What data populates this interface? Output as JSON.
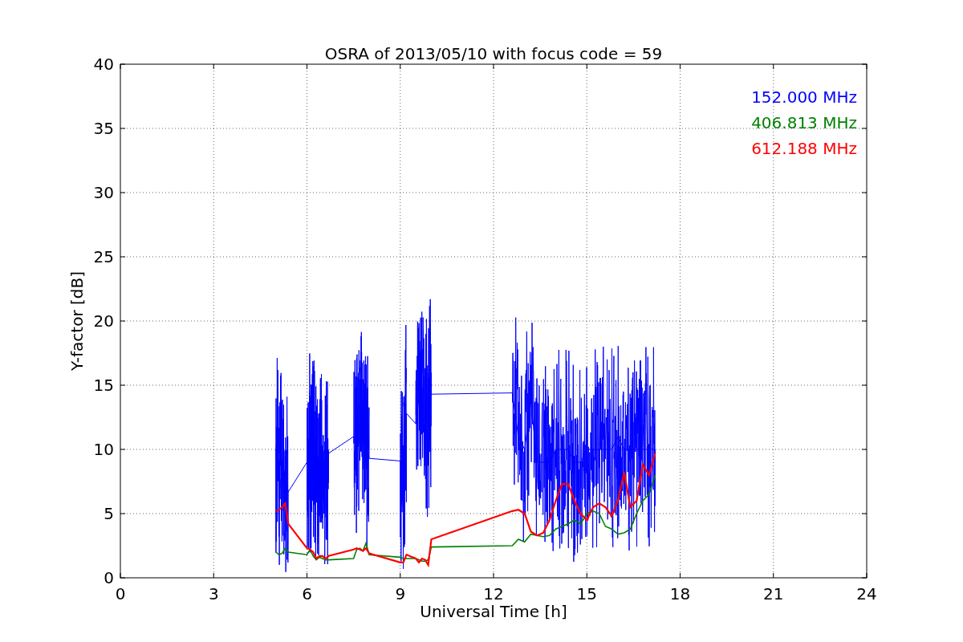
{
  "figure": {
    "chart_data": {
      "type": "line",
      "title": "OSRA of 2013/05/10 with focus code = 59",
      "xlabel": "Universal Time [h]",
      "ylabel": "Y-factor [dB]",
      "x": [
        5.0,
        5.1,
        5.2,
        5.3,
        5.4,
        6.0,
        6.1,
        6.2,
        6.3,
        6.4,
        6.5,
        6.6,
        6.7,
        7.5,
        7.6,
        7.7,
        7.8,
        7.9,
        8.0,
        9.0,
        9.1,
        9.2,
        9.5,
        9.6,
        9.7,
        9.8,
        9.9,
        10.0,
        12.6,
        12.8,
        13.0,
        13.2,
        13.4,
        13.6,
        13.8,
        14.0,
        14.2,
        14.4,
        14.6,
        14.8,
        15.0,
        15.2,
        15.4,
        15.6,
        15.8,
        16.0,
        16.2,
        16.4,
        16.6,
        16.8,
        17.0,
        17.2
      ],
      "series": [
        {
          "name": "152.000 MHz",
          "color": "#0000ff",
          "values": [
            10,
            9,
            9,
            8,
            6.7,
            9,
            10,
            10,
            9,
            8,
            8,
            7,
            9.7,
            11,
            11,
            12,
            11,
            10,
            9.3,
            9.1,
            8,
            12.8,
            12,
            14,
            13,
            12,
            13,
            14.3,
            14.4,
            11,
            10,
            13.8,
            9,
            9,
            9,
            10,
            10,
            10,
            9,
            9,
            10,
            10,
            10,
            10,
            10,
            11,
            10,
            10,
            10,
            10,
            10,
            10
          ]
        },
        {
          "name": "406.813 MHz",
          "color": "#008000",
          "values": [
            2,
            1.8,
            1.9,
            2.3,
            2.0,
            1.8,
            2.2,
            1.7,
            1.4,
            1.6,
            1.5,
            1.4,
            1.4,
            1.5,
            2.2,
            2.3,
            2.1,
            2.7,
            1.8,
            1.6,
            1.5,
            1.5,
            1.5,
            1.4,
            1.3,
            1.3,
            1.4,
            2.4,
            2.5,
            3,
            2.8,
            3.4,
            3.3,
            3.2,
            3.3,
            3.8,
            4,
            4.2,
            4.5,
            4.2,
            5,
            5.2,
            5,
            4,
            3.8,
            3.4,
            3.5,
            3.8,
            5,
            6,
            6.5,
            8
          ]
        },
        {
          "name": "612.188 MHz",
          "color": "#ff0000",
          "values": [
            5.2,
            5.3,
            5.5,
            5.8,
            4.2,
            2.3,
            2.2,
            2,
            1.5,
            1.7,
            1.7,
            1.5,
            1.7,
            2.2,
            2.3,
            2.2,
            2.1,
            2.3,
            1.9,
            1.2,
            1.2,
            1.8,
            1.5,
            1.2,
            1.5,
            1.4,
            1.0,
            3.0,
            5.2,
            5.3,
            5,
            3.6,
            3.3,
            3.5,
            4.5,
            6,
            7.3,
            7.3,
            6,
            5,
            4.5,
            5.5,
            5.8,
            5.5,
            4.8,
            6,
            8.2,
            5.5,
            6,
            8.8,
            8,
            9.7
          ]
        }
      ],
      "grid": true,
      "xlim": [
        0,
        24
      ],
      "ylim": [
        0,
        40
      ],
      "xticks": [
        0,
        3,
        6,
        9,
        12,
        15,
        18,
        21,
        24
      ],
      "yticks": [
        0,
        5,
        10,
        15,
        20,
        25,
        30,
        35,
        40
      ]
    }
  }
}
